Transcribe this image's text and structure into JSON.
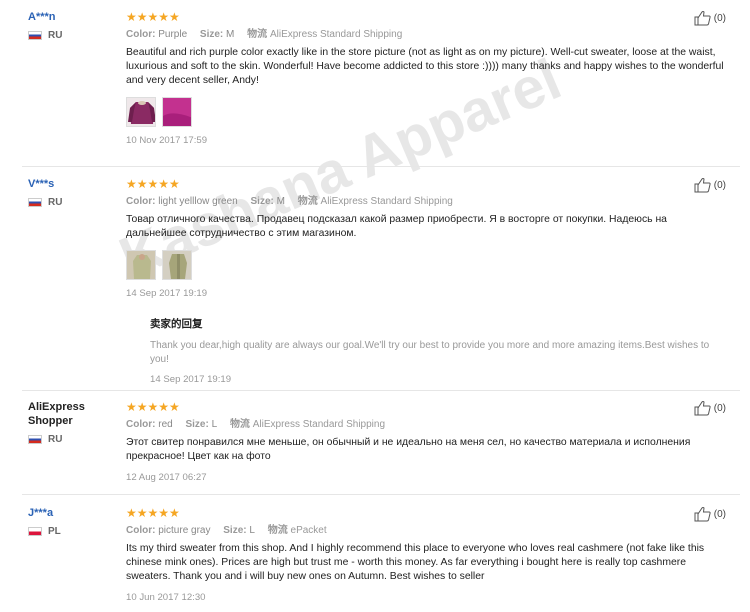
{
  "labels": {
    "color": "Color:",
    "size": "Size:",
    "shipping_cn": "物流",
    "reply_title": "卖家的回复"
  },
  "stars": "★★★★★",
  "watermark": "Kashana Apparel",
  "reviews": [
    {
      "user": "A***n",
      "country": "RU",
      "color": "Purple",
      "size": "M",
      "shipping": "AliExpress Standard Shipping",
      "text": "Beautiful and rich purple color exactly like in the store picture (not as light as on my picture). Well-cut sweater, loose at the waist, luxurious and soft to the skin. Wonderful! Have become addicted to this store :)))) many thanks and happy wishes to the wonderful and very decent seller, Andy!",
      "date": "10 Nov 2017 17:59",
      "likes": "(0)"
    },
    {
      "user": "V***s",
      "country": "RU",
      "color": "light yelllow green",
      "size": "M",
      "shipping": "AliExpress Standard Shipping",
      "text": "Товар отличного качества. Продавец подсказал какой размер приобрести. Я в восторге от покупки. Надеюсь на дальнейшее сотрудничество с этим магазином.",
      "date": "14 Sep 2017 19:19",
      "likes": "(0)",
      "reply": {
        "text": "Thank you dear,high quality are always our goal.We'll try our best to provide you more and more amazing items.Best wishes to you!",
        "date": "14 Sep 2017 19:19"
      }
    },
    {
      "user": "AliExpress Shopper",
      "country": "RU",
      "color": "red",
      "size": "L",
      "shipping": "AliExpress Standard Shipping",
      "text": "Этот свитер понравился мне меньше, он обычный и не идеально на меня сел, но качество материала и исполнения прекрасное! Цвет как на фото",
      "date": "12 Aug 2017 06:27",
      "likes": "(0)"
    },
    {
      "user": "J***a",
      "country": "PL",
      "color": "picture gray",
      "size": "L",
      "shipping": "ePacket",
      "text": "Its my third sweater from this shop. And I highly recommend this place to everyone who loves real cashmere (not fake like this chinese mink ones). Prices are high but trust me - worth this money. As far everything i bought here is really top cashmere sweaters. Thank you and i will buy new ones on Autumn. Best wishes to seller",
      "date": "10 Jun 2017 12:30",
      "likes": "(0)"
    }
  ]
}
